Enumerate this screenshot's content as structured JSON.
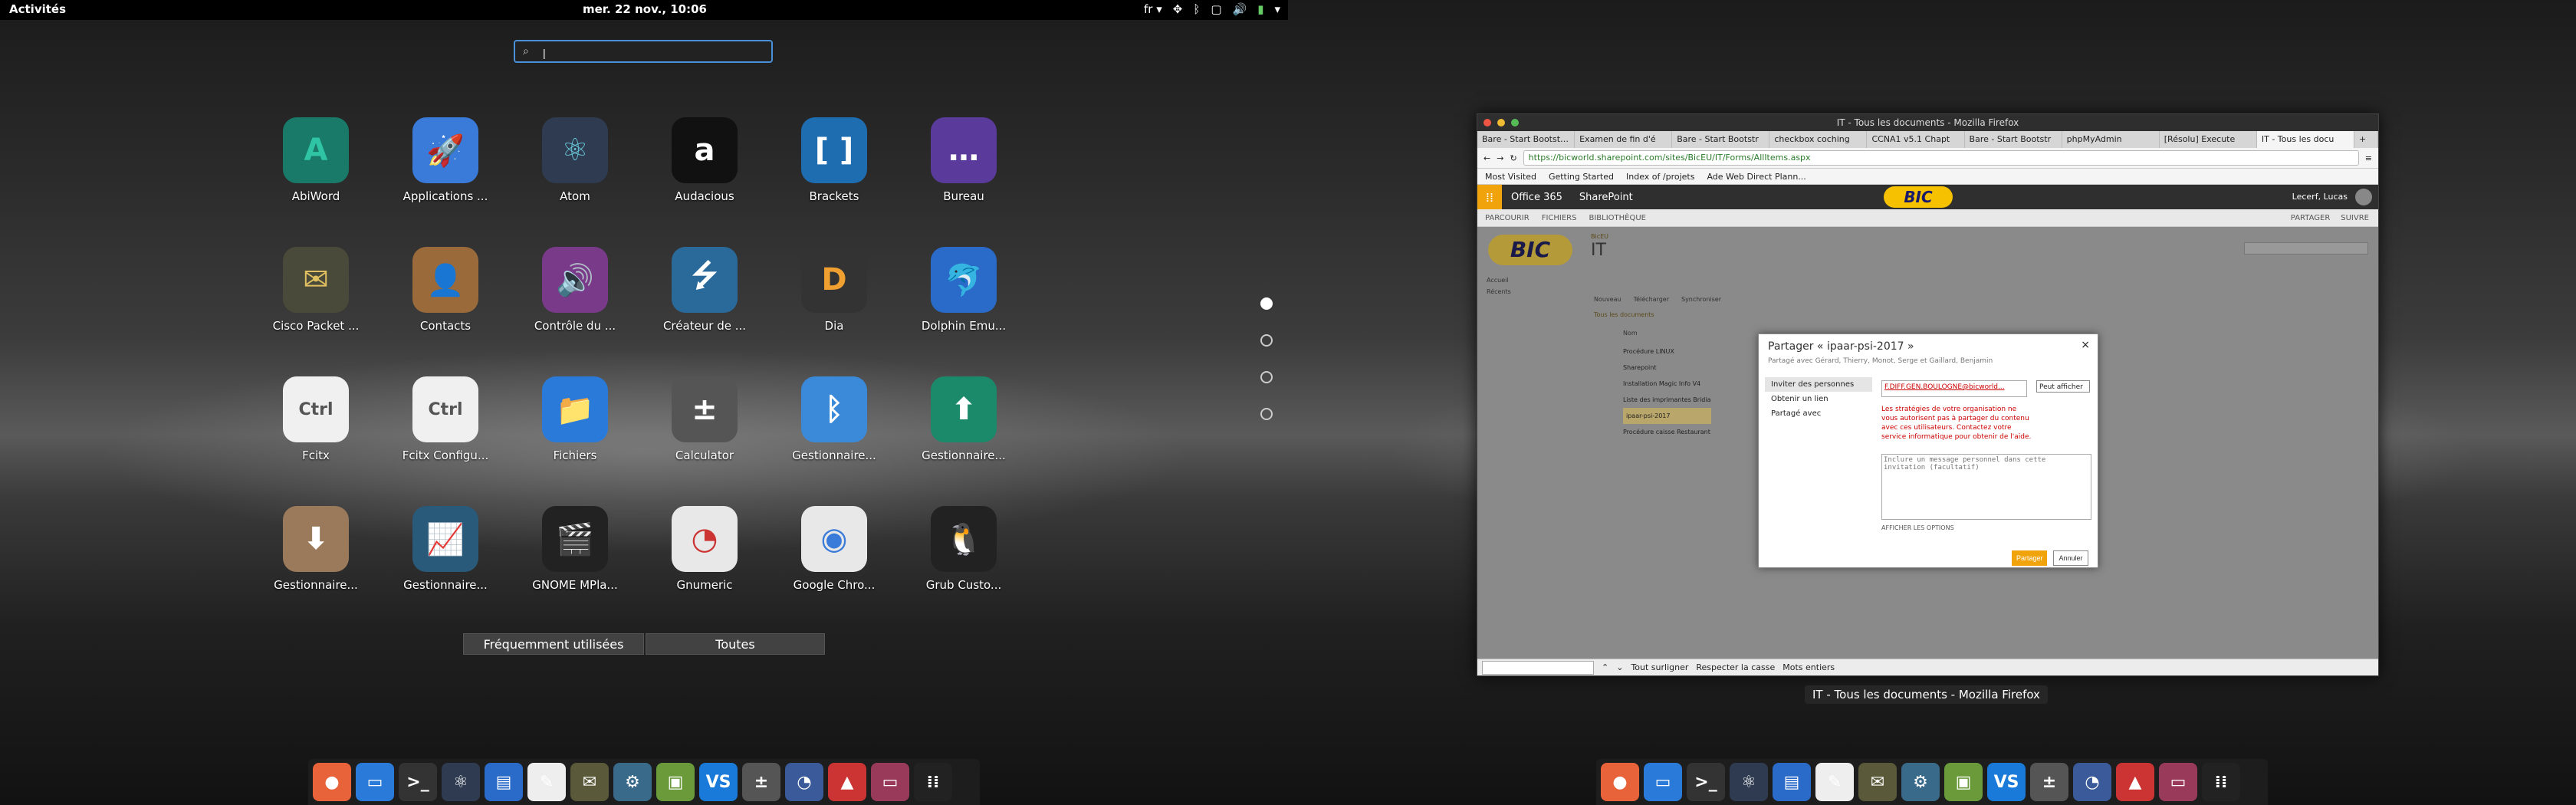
{
  "left": {
    "topbar": {
      "activities": "Activités",
      "clock": "mer. 22 nov., 10:06",
      "lang": "fr ▾"
    },
    "search": {
      "placeholder": "",
      "value": "|"
    },
    "apps": [
      {
        "label": "AbiWord",
        "icon": "abiword-icon",
        "glyph": "A",
        "bg": "#1a7a6a",
        "fg": "#2ec4a4"
      },
      {
        "label": "Applications ...",
        "icon": "rocket-icon",
        "glyph": "🚀",
        "bg": "#3a7ad9",
        "fg": "#fff"
      },
      {
        "label": "Atom",
        "icon": "atom-icon",
        "glyph": "⚛",
        "bg": "#2e3b50",
        "fg": "#68c7d8"
      },
      {
        "label": "Audacious",
        "icon": "audacious-icon",
        "glyph": "a",
        "bg": "#111",
        "fg": "#fff"
      },
      {
        "label": "Brackets",
        "icon": "brackets-icon",
        "glyph": "[ ]",
        "bg": "#1e6db0",
        "fg": "#fff"
      },
      {
        "label": "Bureau",
        "icon": "desktop-icon",
        "glyph": "…",
        "bg": "#5a3a9a",
        "fg": "#fff"
      },
      {
        "label": "Cisco Packet ...",
        "icon": "cisco-packet-tracer-icon",
        "glyph": "✉",
        "bg": "#4a4a3a",
        "fg": "#e0c060"
      },
      {
        "label": "Contacts",
        "icon": "contacts-icon",
        "glyph": "👤",
        "bg": "#9a6a3a",
        "fg": "#fff"
      },
      {
        "label": "Contrôle du ...",
        "icon": "volume-icon",
        "glyph": "🔊",
        "bg": "#7a3a8a",
        "fg": "#fff"
      },
      {
        "label": "Créateur de ...",
        "icon": "usb-creator-icon",
        "glyph": "⭍",
        "bg": "#2a6a9a",
        "fg": "#fff"
      },
      {
        "label": "Dia",
        "icon": "dia-icon",
        "glyph": "D",
        "bg": "#333",
        "fg": "#f0a030"
      },
      {
        "label": "Dolphin Emu...",
        "icon": "dolphin-icon",
        "glyph": "🐬",
        "bg": "#2a6ac9",
        "fg": "#fff"
      },
      {
        "label": "Fcitx",
        "icon": "fcitx-icon",
        "glyph": "Ctrl",
        "bg": "#f0f0f0",
        "fg": "#555"
      },
      {
        "label": "Fcitx Configu...",
        "icon": "fcitx-config-icon",
        "glyph": "Ctrl",
        "bg": "#f0f0f0",
        "fg": "#555"
      },
      {
        "label": "Fichiers",
        "icon": "folder-icon",
        "glyph": "📁",
        "bg": "#2a7ad9",
        "fg": "#fff"
      },
      {
        "label": "Calculator",
        "icon": "calculator-icon",
        "glyph": "±",
        "bg": "#555",
        "fg": "#fff"
      },
      {
        "label": "Gestionnaire...",
        "icon": "bluetooth-icon",
        "glyph": "ᛒ",
        "bg": "#3a8ad9",
        "fg": "#fff"
      },
      {
        "label": "Gestionnaire...",
        "icon": "upload-icon",
        "glyph": "⬆",
        "bg": "#1a8a6a",
        "fg": "#fff"
      },
      {
        "label": "Gestionnaire...",
        "icon": "download-icon",
        "glyph": "⬇",
        "bg": "#9a7a5a",
        "fg": "#fff"
      },
      {
        "label": "Gestionnaire...",
        "icon": "system-monitor-icon",
        "glyph": "📈",
        "bg": "#2a5a7a",
        "fg": "#e0d040"
      },
      {
        "label": "GNOME MPla...",
        "icon": "clapperboard-icon",
        "glyph": "🎬",
        "bg": "#222",
        "fg": "#fff"
      },
      {
        "label": "Gnumeric",
        "icon": "gnumeric-icon",
        "glyph": "◔",
        "bg": "#e8e8e8",
        "fg": "#c33"
      },
      {
        "label": "Google Chro...",
        "icon": "chrome-icon",
        "glyph": "◉",
        "bg": "#e8e8e8",
        "fg": "#3a7ad9"
      },
      {
        "label": "Grub Custo...",
        "icon": "tux-icon",
        "glyph": "🐧",
        "bg": "#222",
        "fg": "#fff"
      }
    ],
    "segments": {
      "frequent": "Fréquemment utilisées",
      "all": "Toutes"
    }
  },
  "right": {
    "window": {
      "title": "IT - Tous les documents - Mozilla Firefox",
      "tabs": [
        "Bare - Start Bootstrap",
        "Examen de fin d'é",
        "Bare - Start Bootstr",
        "checkbox coching",
        "CCNA1 v5.1 Chapt",
        "Bare - Start Bootstr",
        "phpMyAdmin",
        "[Résolu] Execute",
        "IT - Tous les docu"
      ],
      "url": "https://bicworld.sharepoint.com/sites/BicEU/IT/Forms/AllItems.aspx",
      "bookmarks": [
        "Most Visited",
        "Getting Started",
        "Index of /projets",
        "Ade Web Direct Plann..."
      ],
      "o365": {
        "brand": "Office 365",
        "app": "SharePoint",
        "logo": "BIC",
        "user": "Lecerf, Lucas"
      },
      "ribbon": [
        "PARCOURIR",
        "FICHIERS",
        "BIBLIOTHÈQUE"
      ],
      "ribbon_right": [
        "PARTAGER",
        "SUIVRE"
      ],
      "site_logo": "BIC",
      "site_title": "IT",
      "site_crumb": "BicEU",
      "left_nav": [
        "Accueil",
        "Récents"
      ],
      "doc_actions": [
        "Nouveau",
        "Télécharger",
        "Synchroniser"
      ],
      "view_label": "Tous les documents",
      "list_header": "Nom",
      "doc_items": [
        "Procédure LINUX",
        "Sharepoint",
        "Installation Magic Info V4",
        "Liste des imprimantes Bridia",
        "ipaar-psi-2017",
        "Procédure caisse Restaurant"
      ],
      "dialog": {
        "title": "Partager « ipaar-psi-2017 »",
        "shared_with": "Partagé avec Gérard, Thierry, Monot, Serge et Gaillard, Benjamin",
        "side": [
          "Inviter des personnes",
          "Obtenir un lien",
          "Partagé avec"
        ],
        "recipient": "F.DIFF.GEN.BOULOGNE@bicworld...",
        "permission": "Peut afficher",
        "error": "Les stratégies de votre organisation ne vous autorisent pas à partager du contenu avec ces utilisateurs. Contactez votre service informatique pour obtenir de l'aide.",
        "message_placeholder": "Inclure un message personnel dans cette invitation (facultatif)",
        "options": "AFFICHER LES OPTIONS",
        "share": "Partager",
        "cancel": "Annuler"
      },
      "findbar": {
        "highlight": "Tout surligner",
        "match_case": "Respecter la casse",
        "whole_words": "Mots entiers"
      }
    },
    "caption": "IT - Tous les documents - Mozilla Firefox"
  },
  "dock": [
    {
      "icon": "firefox-icon",
      "glyph": "●",
      "bg": "#e8623a"
    },
    {
      "icon": "files-icon",
      "glyph": "▭",
      "bg": "#2a7ad9"
    },
    {
      "icon": "terminal-icon",
      "glyph": ">_",
      "bg": "#333"
    },
    {
      "icon": "atom-icon",
      "glyph": "⚛",
      "bg": "#2e3b50"
    },
    {
      "icon": "writer-icon",
      "glyph": "▤",
      "bg": "#2a6ac9"
    },
    {
      "icon": "draw-icon",
      "glyph": "✎",
      "bg": "#eee"
    },
    {
      "icon": "cisco-icon",
      "glyph": "✉",
      "bg": "#5a5a3a"
    },
    {
      "icon": "network-icon",
      "glyph": "⚙",
      "bg": "#3a6a8a"
    },
    {
      "icon": "image-viewer-icon",
      "glyph": "▣",
      "bg": "#6a9a3a"
    },
    {
      "icon": "vscode-icon",
      "glyph": "VS",
      "bg": "#1a7ad9"
    },
    {
      "icon": "calculator-icon",
      "glyph": "±",
      "bg": "#555"
    },
    {
      "icon": "monitor-icon",
      "glyph": "◔",
      "bg": "#3a5a9a"
    },
    {
      "icon": "pdf-icon",
      "glyph": "▲",
      "bg": "#c33"
    },
    {
      "icon": "screen-icon",
      "glyph": "▭",
      "bg": "#9a3a5a"
    },
    {
      "icon": "app-grid-icon",
      "glyph": "⁞⁞",
      "bg": "#222"
    }
  ]
}
